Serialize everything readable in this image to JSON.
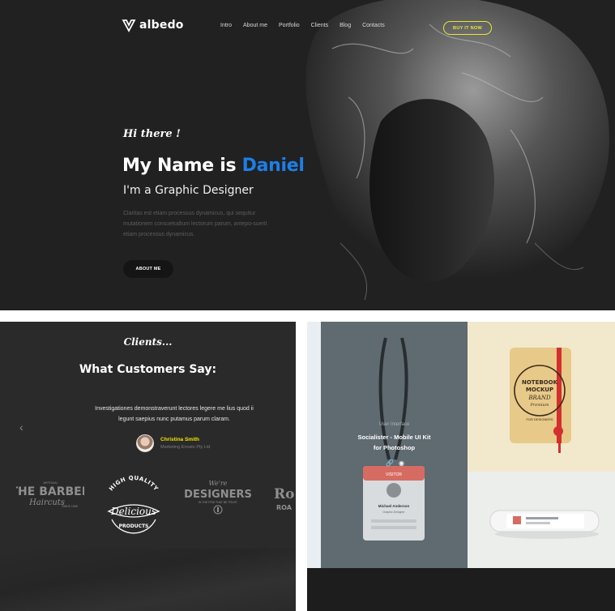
{
  "nav": {
    "brand": "albedo",
    "items": [
      "Intro",
      "About me",
      "Portfolio",
      "Clients",
      "Blog",
      "Contacts"
    ],
    "cta": "BUY IT NOW"
  },
  "hero": {
    "greeting": "Hi there !",
    "headline_prefix": "My Name is ",
    "headline_name": "Daniel",
    "role": "I'm a Graphic Designer",
    "description": "Claritas est etiam processus dynamicus, qui sequitur mutationem consuetudium lectorum parum, antepo-suerit etiam processus dynamicus.",
    "button": "ABOUT ME"
  },
  "clients": {
    "script_title": "Clients...",
    "title": "What Customers Say:",
    "quote": "Investigationes demonstraverunt lectores legere me lius quod ii legunt saepius nunc putamus parum claram.",
    "author_name": "Christina Smith",
    "author_role": "Marketing Envato Pty Ltd",
    "logos": {
      "barber_line1": "ARTISAN",
      "barber_line2": "THE BARBER",
      "barber_line3": "Haircuts",
      "barber_line4": "SINCE 1999",
      "delicious_top": "HIGH QUALITY",
      "delicious_main": "Delicious",
      "delicious_bottom": "PRODUCTS",
      "designers_top": "We're",
      "designers_main": "DESIGNERS",
      "designers_sub": "IN THE FEW THAT BE TRUST",
      "partial_main": "Ro",
      "partial_sub": "ROA"
    }
  },
  "portfolio": {
    "category": "User Interface",
    "title_line1": "Socialister - Mobile UI Kit",
    "title_line2": "for Photoshop",
    "badge_header": "VISITOR",
    "badge_name": "Michael Anderson",
    "badge_role": "Graphic Designer",
    "notebook_lines": [
      "NOTEBOOK",
      "MOCKUP",
      "BRAND",
      "Premium"
    ],
    "notebook_ring": "FOR DESIGNERS"
  },
  "colors": {
    "accent_blue": "#1d7fe6",
    "cta_yellow": "#e8e635",
    "author_yellow": "#f2e200",
    "hero_bg": "#212121",
    "portfolio_overlay": "#5f6a71"
  }
}
